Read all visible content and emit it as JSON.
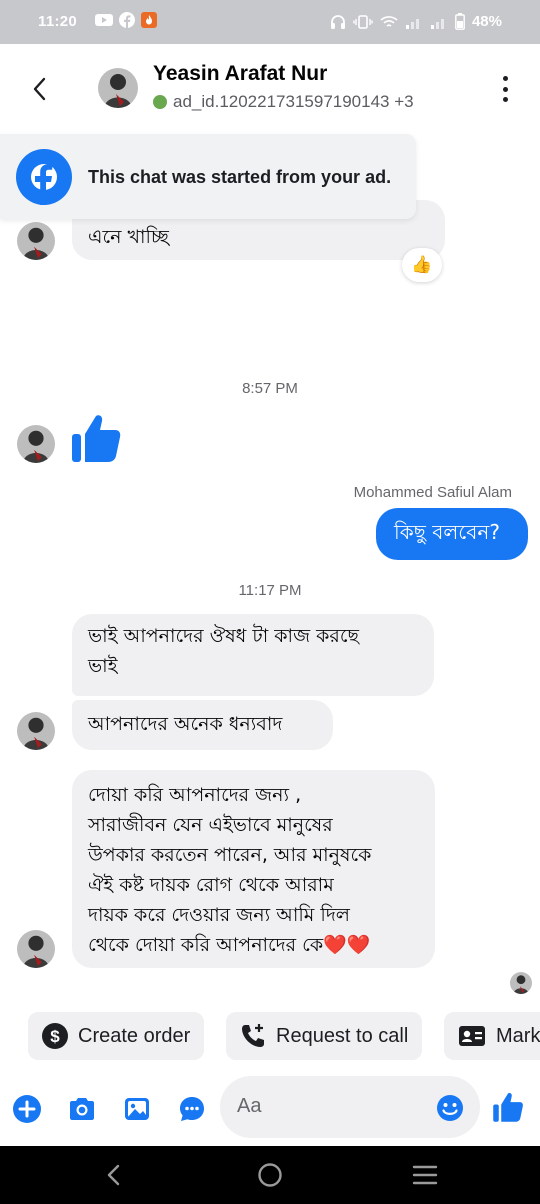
{
  "status_bar": {
    "time": "11:20",
    "battery": "48%",
    "app_icons": [
      "youtube-icon",
      "facebook-icon",
      "fire-app-icon"
    ]
  },
  "header": {
    "contact_name": "Yeasin Arafat Nur",
    "subtitle": "ad_id.120221731597190143 +3",
    "online_color": "#6aa84f"
  },
  "ad_banner": {
    "text": "This chat was started from your ad."
  },
  "messages": {
    "m1": "এনে খাচ্ছি",
    "m1_reaction": "👍",
    "time1": "8:57 PM",
    "sender_name": "Mohammed Safiul Alam",
    "m2": "কিছু বলবেন?",
    "time2": "11:17 PM",
    "m3_line1": "ভাই আপনাদের  ঔষধ টা  কাজ করছে",
    "m3_line2": "ভাই",
    "m4": "আপনাদের অনেক ধন্যবাদ",
    "m5_line1": "দোয়া করি আপনাদের  জন্য ,",
    "m5_line2": "সারাজীবন  যেন এইভাবে মানুষের",
    "m5_line3": "উপকার করতেন পারেন, আর মানুষকে",
    "m5_line4": "ঐই কষ্ট  দায়ক রোগ থেকে আরাম",
    "m5_line5": "দায়ক করে  দেওয়ার জন্য  আমি দিল",
    "m5_line6": "থেকে দোয়া করি আপনাদের কে❤️❤️"
  },
  "quick_actions": {
    "create_order": "Create order",
    "request_call": "Request to call",
    "mark": "Mark"
  },
  "composer": {
    "placeholder": "Aa"
  },
  "colors": {
    "accent": "#1877f2",
    "incoming_bubble": "#f0f0f2",
    "status_bar": "#c7c8cc"
  }
}
